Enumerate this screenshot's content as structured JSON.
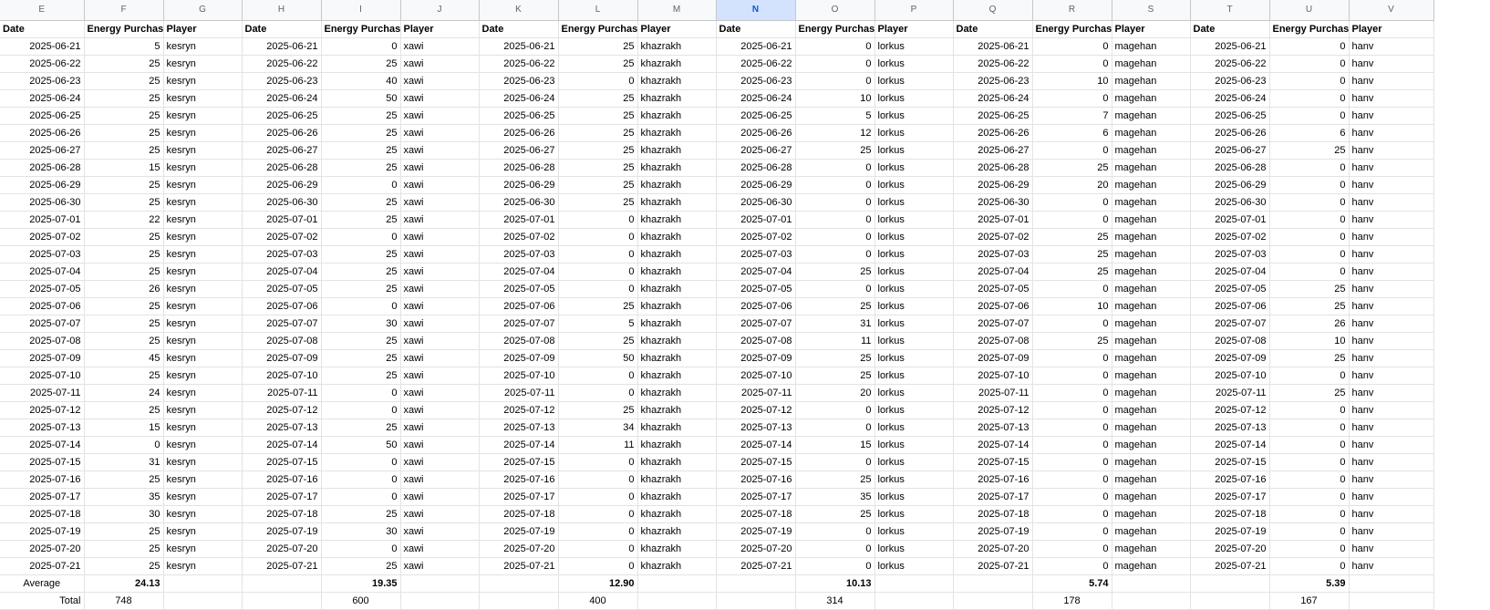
{
  "columns": [
    "E",
    "F",
    "G",
    "H",
    "I",
    "J",
    "K",
    "L",
    "M",
    "N",
    "O",
    "P",
    "Q",
    "R",
    "S",
    "T",
    "U",
    "V"
  ],
  "selected_column": "N",
  "header_row": [
    "Date",
    "Energy Purchase",
    "Player",
    "Date",
    "Energy Purchase",
    "Player",
    "Date",
    "Energy Purchase",
    "Player",
    "Date",
    "Energy Purchase",
    "Player",
    "Date",
    "Energy Purchase",
    "Player",
    "Date",
    "Energy Purchase",
    "Player"
  ],
  "players": [
    "kesryn",
    "xawi",
    "khazrakh",
    "lorkus",
    "magehan",
    "hanv"
  ],
  "dates": [
    "2025-06-21",
    "2025-06-22",
    "2025-06-23",
    "2025-06-24",
    "2025-06-25",
    "2025-06-26",
    "2025-06-27",
    "2025-06-28",
    "2025-06-29",
    "2025-06-30",
    "2025-07-01",
    "2025-07-02",
    "2025-07-03",
    "2025-07-04",
    "2025-07-05",
    "2025-07-06",
    "2025-07-07",
    "2025-07-08",
    "2025-07-09",
    "2025-07-10",
    "2025-07-11",
    "2025-07-12",
    "2025-07-13",
    "2025-07-14",
    "2025-07-15",
    "2025-07-16",
    "2025-07-17",
    "2025-07-18",
    "2025-07-19",
    "2025-07-20",
    "2025-07-21"
  ],
  "values": {
    "kesryn": [
      5,
      25,
      25,
      25,
      25,
      25,
      25,
      15,
      25,
      25,
      22,
      25,
      25,
      25,
      26,
      25,
      25,
      25,
      45,
      25,
      24,
      25,
      15,
      0,
      31,
      25,
      35,
      30,
      25,
      25,
      25
    ],
    "xawi": [
      0,
      25,
      40,
      50,
      25,
      25,
      25,
      25,
      0,
      25,
      25,
      0,
      25,
      25,
      25,
      0,
      30,
      25,
      25,
      25,
      0,
      0,
      25,
      50,
      0,
      0,
      0,
      25,
      30,
      0,
      25
    ],
    "khazrakh": [
      25,
      25,
      0,
      25,
      25,
      25,
      25,
      25,
      25,
      25,
      0,
      0,
      0,
      0,
      0,
      25,
      5,
      25,
      50,
      0,
      0,
      25,
      34,
      11,
      0,
      0,
      0,
      0,
      0,
      0,
      0
    ],
    "lorkus": [
      0,
      0,
      0,
      10,
      5,
      12,
      25,
      0,
      0,
      0,
      0,
      0,
      0,
      25,
      0,
      25,
      31,
      11,
      25,
      25,
      20,
      0,
      0,
      15,
      0,
      25,
      35,
      25,
      0,
      0,
      0
    ],
    "magehan": [
      0,
      0,
      10,
      0,
      7,
      6,
      0,
      25,
      20,
      0,
      0,
      25,
      25,
      25,
      0,
      10,
      0,
      25,
      0,
      0,
      0,
      0,
      0,
      0,
      0,
      0,
      0,
      0,
      0,
      0,
      0
    ],
    "hanv": [
      0,
      0,
      0,
      0,
      0,
      6,
      25,
      0,
      0,
      0,
      0,
      0,
      0,
      0,
      25,
      25,
      26,
      10,
      25,
      0,
      25,
      0,
      0,
      0,
      0,
      0,
      0,
      0,
      0,
      0,
      0
    ]
  },
  "average_label": "Average",
  "total_label": "Total",
  "averages": [
    "24.13",
    "19.35",
    "12.90",
    "10.13",
    "5.74",
    "5.39"
  ],
  "totals": [
    "748",
    "600",
    "400",
    "314",
    "178",
    "167"
  ]
}
